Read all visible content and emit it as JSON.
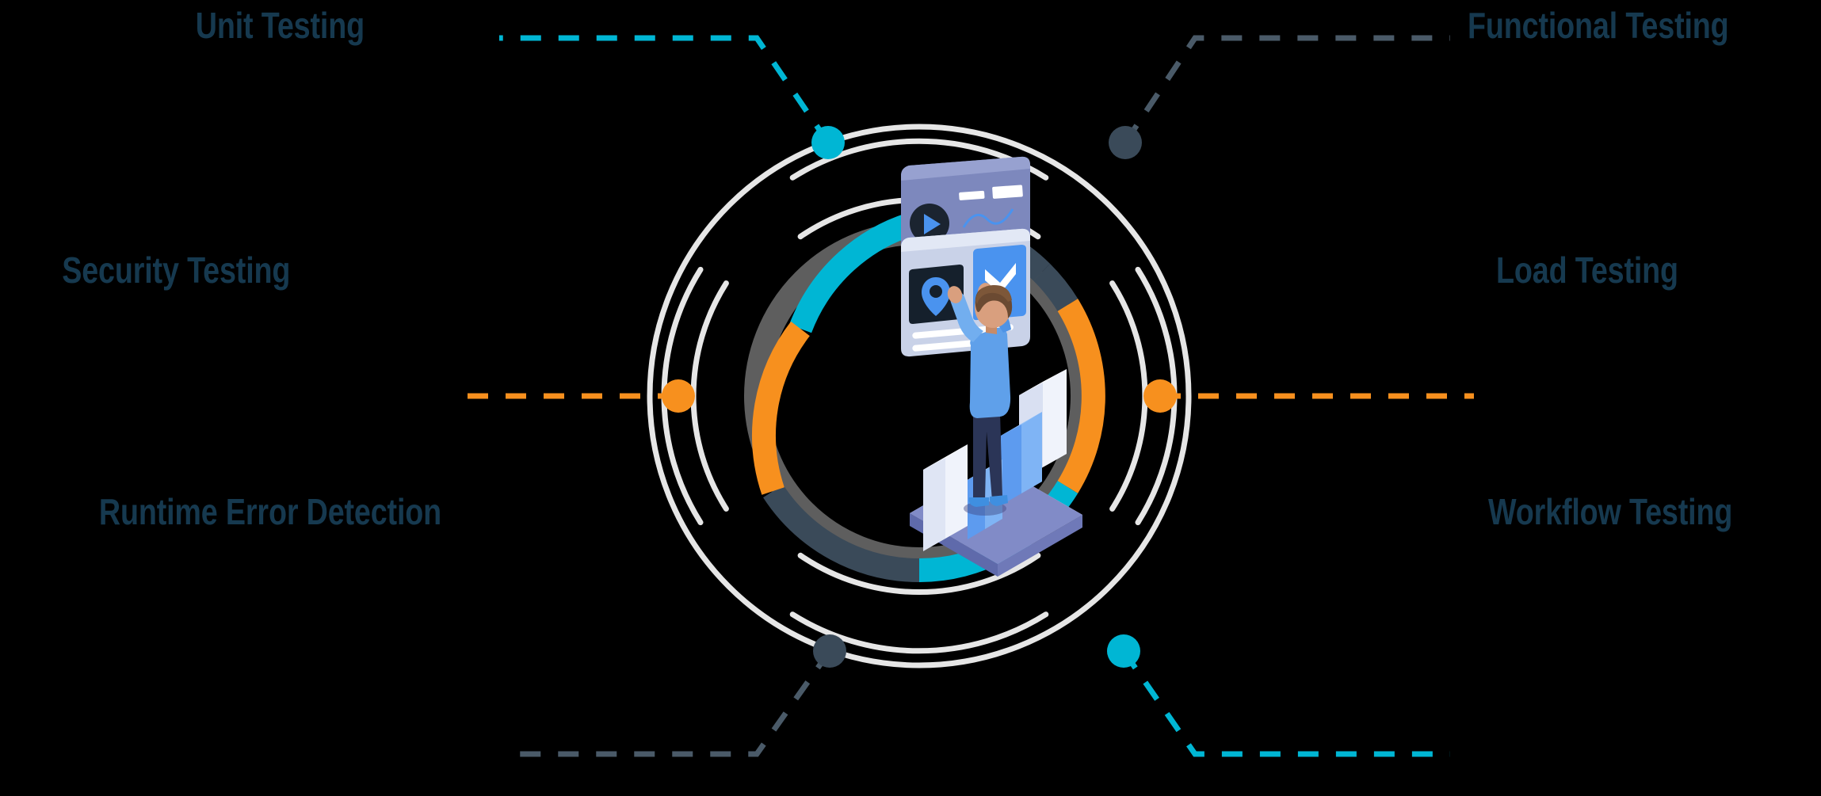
{
  "diagram": {
    "type": "radial-hub-and-spoke",
    "title_visible": false,
    "center_illustration": "analytics-dashboard-isometric-illustration",
    "colors": {
      "background": "#000000",
      "label_text": "#16394f",
      "cyan": "#00b6d4",
      "orange": "#f7901e",
      "slate": "#3a4a59",
      "gray_ring": "#5b5b5b",
      "white_ring": "#e8e8e8"
    },
    "nodes": [
      {
        "id": "unit-testing",
        "label": "Unit Testing",
        "side": "left",
        "row": "top",
        "dot_color": "#00b6d4",
        "connector_color": "#00b6d4",
        "connector_style": "dashed"
      },
      {
        "id": "functional-testing",
        "label": "Functional Testing",
        "side": "right",
        "row": "top",
        "dot_color": "#3a4a59",
        "connector_color": "#4a5a68",
        "connector_style": "dashed"
      },
      {
        "id": "security-testing",
        "label": "Security Testing",
        "side": "left",
        "row": "middle",
        "dot_color": "#f7901e",
        "connector_color": "#f7901e",
        "connector_style": "dashed"
      },
      {
        "id": "load-testing",
        "label": "Load Testing",
        "side": "right",
        "row": "middle",
        "dot_color": "#f7901e",
        "connector_color": "#f7901e",
        "connector_style": "dashed"
      },
      {
        "id": "runtime-error-detection",
        "label": "Runtime Error Detection",
        "side": "left",
        "row": "bottom",
        "dot_color": "#3a4a59",
        "connector_color": "#4a5a68",
        "connector_style": "dashed"
      },
      {
        "id": "workflow-testing",
        "label": "Workflow Testing",
        "side": "right",
        "row": "bottom",
        "dot_color": "#00b6d4",
        "connector_color": "#00b6d4",
        "connector_style": "dashed"
      }
    ],
    "ring_segments": [
      {
        "name": "segment-cyan-top",
        "color": "#00b6d4",
        "start_deg": -76,
        "end_deg": 14
      },
      {
        "name": "segment-slate-right",
        "color": "#3a4a59",
        "start_deg": 14,
        "end_deg": 104
      },
      {
        "name": "segment-cyan-bottom",
        "color": "#00b6d4",
        "start_deg": 104,
        "end_deg": 166
      },
      {
        "name": "segment-slate-left",
        "color": "#3a4a59",
        "start_deg": 166,
        "end_deg": 228
      },
      {
        "name": "segment-orange-left",
        "color": "#f7901e",
        "start_deg": 228,
        "end_deg": 284
      }
    ],
    "ring_segments_right": [
      {
        "name": "segment-orange-right",
        "color": "#f7901e",
        "start_deg": 44,
        "end_deg": 104
      }
    ]
  }
}
